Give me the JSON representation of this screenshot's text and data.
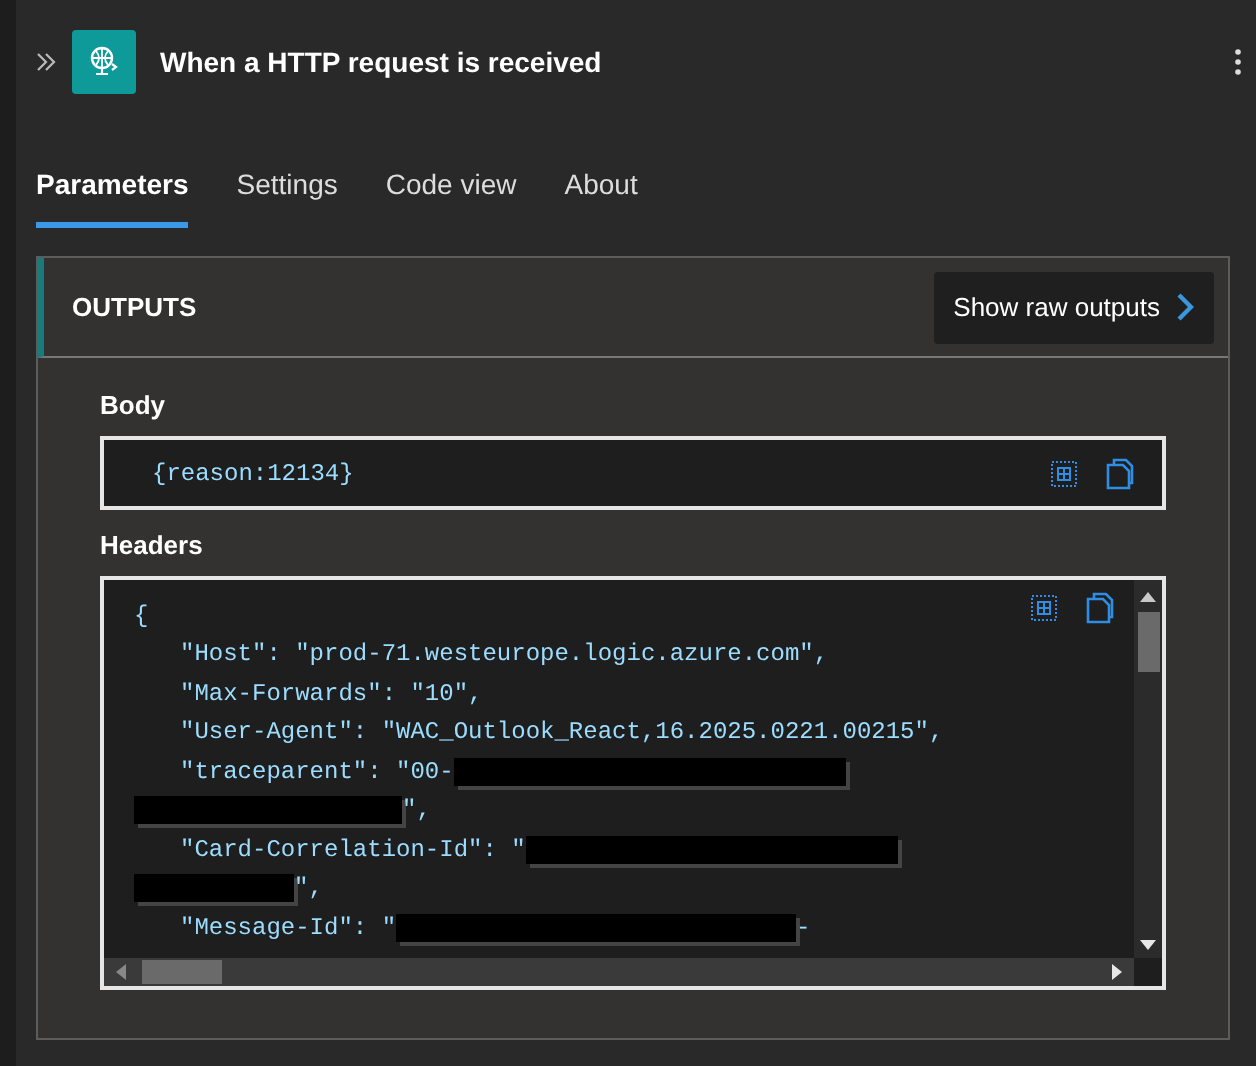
{
  "header": {
    "title": "When a HTTP request is received"
  },
  "tabs": [
    {
      "label": "Parameters",
      "selected": true
    },
    {
      "label": "Settings",
      "selected": false
    },
    {
      "label": "Code view",
      "selected": false
    },
    {
      "label": "About",
      "selected": false
    }
  ],
  "outputs": {
    "title": "OUTPUTS",
    "raw_button": "Show raw outputs",
    "fields": [
      {
        "label": "Body",
        "lines": [
          {
            "indent": false,
            "parts": [
              {
                "kind": "text",
                "text": "{reason:12134}"
              }
            ]
          }
        ]
      },
      {
        "label": "Headers",
        "lines": [
          {
            "indent": false,
            "parts": [
              {
                "kind": "text",
                "text": "{"
              }
            ]
          },
          {
            "indent": true,
            "parts": [
              {
                "kind": "text",
                "text": "\"Host\": \"prod-71.westeurope.logic.azure.com\","
              }
            ]
          },
          {
            "indent": true,
            "parts": [
              {
                "kind": "text",
                "text": "\"Max-Forwards\": \"10\","
              }
            ]
          },
          {
            "indent": true,
            "parts": [
              {
                "kind": "text",
                "text": "\"User-Agent\": \"WAC_Outlook_React,16.2025.0221.00215\","
              }
            ]
          },
          {
            "indent": true,
            "parts": [
              {
                "kind": "text",
                "text": "\"traceparent\": \"00-"
              },
              {
                "kind": "redaction"
              }
            ]
          },
          {
            "indent": false,
            "parts": [
              {
                "kind": "redaction"
              },
              {
                "kind": "text",
                "text": "\","
              }
            ]
          },
          {
            "indent": true,
            "parts": [
              {
                "kind": "text",
                "text": "\"Card-Correlation-Id\": \""
              },
              {
                "kind": "redaction"
              }
            ]
          },
          {
            "indent": false,
            "parts": [
              {
                "kind": "redaction"
              },
              {
                "kind": "text",
                "text": "\","
              }
            ]
          },
          {
            "indent": true,
            "parts": [
              {
                "kind": "text",
                "text": "\"Message-Id\": \""
              },
              {
                "kind": "redaction"
              },
              {
                "kind": "text",
                "text": "-"
              }
            ]
          }
        ]
      }
    ]
  }
}
